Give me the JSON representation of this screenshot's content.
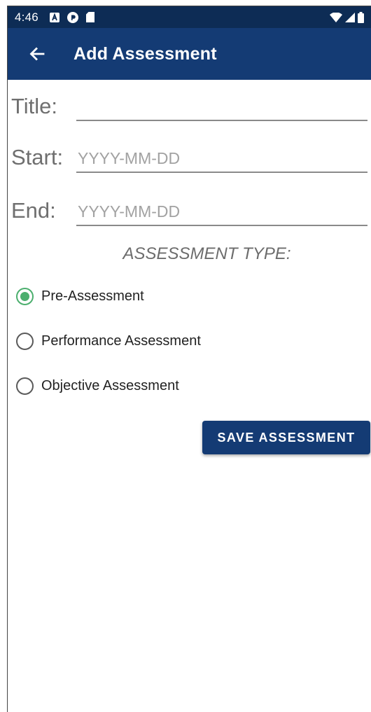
{
  "status_bar": {
    "time": "4:46",
    "icons_left": [
      "notification-a-icon",
      "pocket-casts-icon",
      "sd-card-icon"
    ],
    "icons_right": [
      "wifi-icon",
      "signal-icon",
      "battery-icon"
    ]
  },
  "app_bar": {
    "title": "Add Assessment",
    "back_icon": "arrow-left-icon",
    "color": "#143b74"
  },
  "form": {
    "title_label": "Title:",
    "title_value": "",
    "start_label": "Start:",
    "start_placeholder": "YYYY-MM-DD",
    "end_label": "End:",
    "end_placeholder": "YYYY-MM-DD"
  },
  "assessment_type": {
    "heading": "ASSESSMENT TYPE:",
    "options": [
      {
        "label": "Pre-Assessment",
        "checked": true
      },
      {
        "label": "Performance Assessment",
        "checked": false
      },
      {
        "label": "Objective Assessment",
        "checked": false
      }
    ],
    "accent_color": "#4caf6e"
  },
  "actions": {
    "save_label": "SAVE ASSESSMENT"
  }
}
